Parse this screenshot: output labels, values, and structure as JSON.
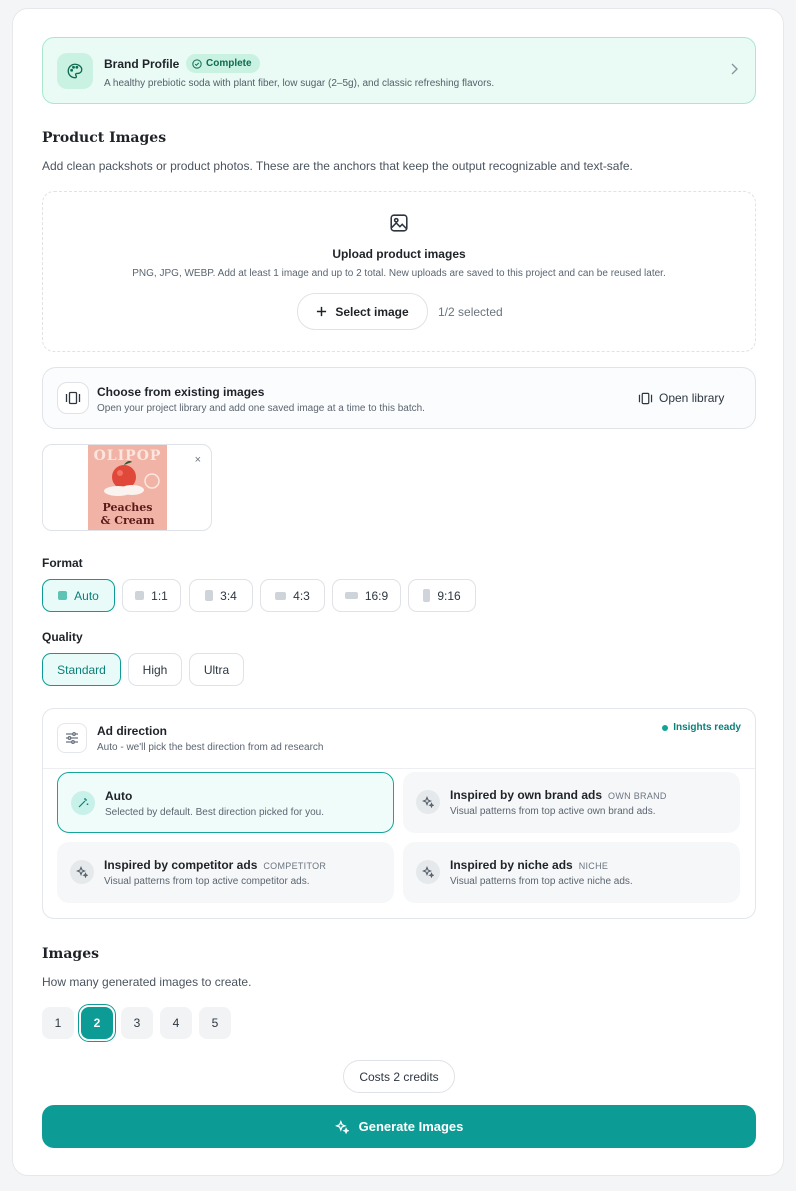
{
  "colors": {
    "accent": "#0d9c95",
    "brand_bg": "#e9fbf4",
    "brand_border": "#a9e8cf"
  },
  "brand": {
    "title": "Brand Profile",
    "status": "Complete",
    "description": "A healthy prebiotic soda with plant fiber, low sugar (2–5g), and classic refreshing flavors.",
    "icon": "palette-icon"
  },
  "product_images": {
    "heading": "Product Images",
    "subtitle": "Add clean packshots or product photos. These are the anchors that keep the output recognizable and text-safe.",
    "upload": {
      "icon": "image-icon",
      "title": "Upload product images",
      "subtitle": "PNG, JPG, WEBP. Add at least 1 image and up to 2 total. New uploads are saved to this project and can be reused later.",
      "button": "Select image",
      "count": "1/2 selected"
    },
    "existing": {
      "title": "Choose from existing images",
      "subtitle": "Open your project library and add one saved image at a time to this batch.",
      "button": "Open library"
    },
    "thumbnail": {
      "brand": "OLIPOP",
      "flavor_line1": "Peaches",
      "flavor_line2": "& Cream",
      "remove": "×"
    }
  },
  "format": {
    "label": "Format",
    "options": [
      "Auto",
      "1:1",
      "3:4",
      "4:3",
      "16:9",
      "9:16"
    ],
    "selected": "Auto"
  },
  "quality": {
    "label": "Quality",
    "options": [
      "Standard",
      "High",
      "Ultra"
    ],
    "selected": "Standard"
  },
  "ad_direction": {
    "title": "Ad direction",
    "subtitle": "Auto - we'll pick the best direction from ad research",
    "status": "Insights ready",
    "options": [
      {
        "title": "Auto",
        "tag": "",
        "subtitle": "Selected by default. Best direction picked for you."
      },
      {
        "title": "Inspired by own brand ads",
        "tag": "OWN BRAND",
        "subtitle": "Visual patterns from top active own brand ads."
      },
      {
        "title": "Inspired by competitor ads",
        "tag": "COMPETITOR",
        "subtitle": "Visual patterns from top active competitor ads."
      },
      {
        "title": "Inspired by niche ads",
        "tag": "NICHE",
        "subtitle": "Visual patterns from top active niche ads."
      }
    ]
  },
  "images": {
    "heading": "Images",
    "subtitle": "How many generated images to create.",
    "counts": [
      "1",
      "2",
      "3",
      "4",
      "5"
    ],
    "selected": "2"
  },
  "cost": "Costs 2 credits",
  "generate_button": "Generate Images"
}
